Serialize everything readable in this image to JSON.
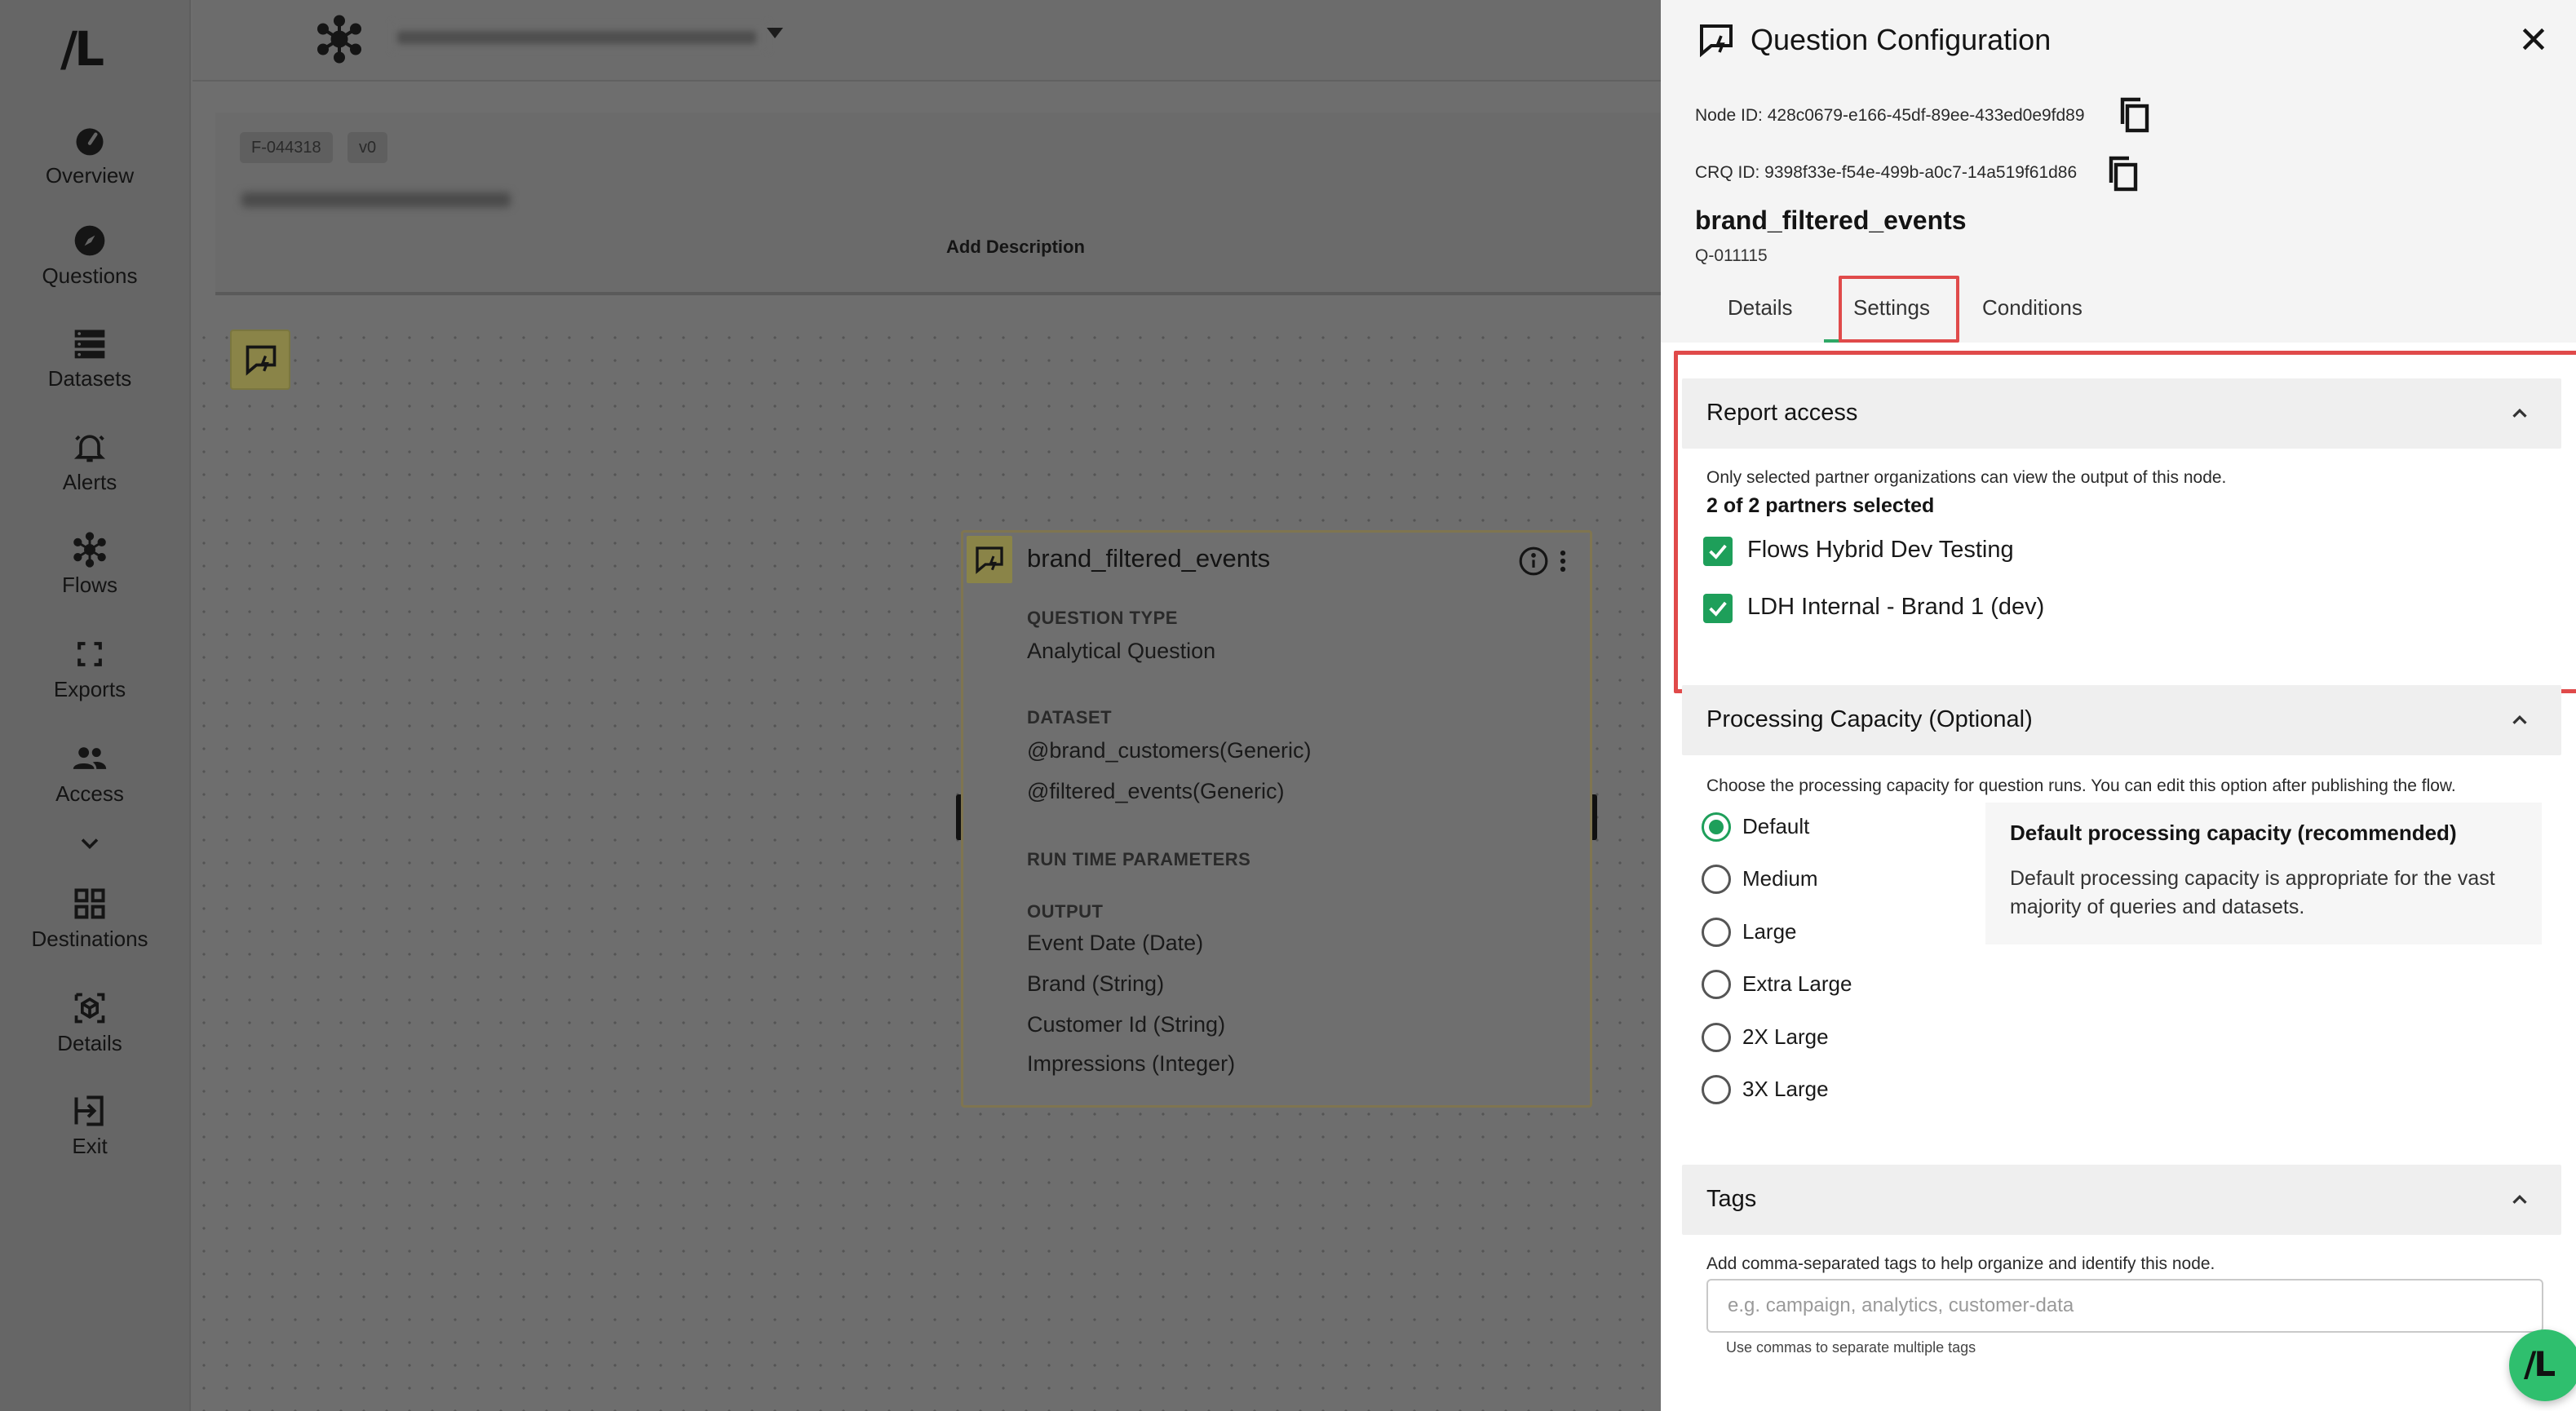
{
  "rail": {
    "logo": "/L",
    "items": [
      {
        "label": "Overview",
        "icon": "gauge-icon"
      },
      {
        "label": "Questions",
        "icon": "compass-icon"
      },
      {
        "label": "Datasets",
        "icon": "database-icon"
      },
      {
        "label": "Alerts",
        "icon": "bell-icon"
      },
      {
        "label": "Flows",
        "icon": "flow-network-icon"
      },
      {
        "label": "Exports",
        "icon": "frame-corners-icon"
      },
      {
        "label": "Access",
        "icon": "people-icon"
      },
      {
        "label": "Destinations",
        "icon": "grid-icon"
      },
      {
        "label": "Details",
        "icon": "cube-icon"
      },
      {
        "label": "Exit",
        "icon": "exit-icon"
      }
    ]
  },
  "flow_card": {
    "badge_id": "F-044318",
    "badge_version": "v0",
    "add_description": "Add Description"
  },
  "question_node": {
    "title": "brand_filtered_events",
    "question_type_label": "QUESTION TYPE",
    "question_type": "Analytical Question",
    "dataset_label": "DATASET",
    "datasets": [
      "@brand_customers(Generic)",
      "@filtered_events(Generic)"
    ],
    "runtime_label": "RUN TIME PARAMETERS",
    "output_label": "OUTPUT",
    "outputs": [
      "Event Date (Date)",
      "Brand (String)",
      "Customer Id (String)",
      "Impressions (Integer)"
    ]
  },
  "panel": {
    "title": "Question Configuration",
    "node_id": "Node ID: 428c0679-e166-45df-89ee-433ed0e9fd89",
    "crq_id": "CRQ ID: 9398f33e-f54e-499b-a0c7-14a519f61d86",
    "name": "brand_filtered_events",
    "qid": "Q-011115",
    "tabs": [
      "Details",
      "Settings",
      "Conditions"
    ],
    "active_tab": "Settings"
  },
  "report_access": {
    "title": "Report access",
    "description": "Only selected partner organizations can view the output of this node.",
    "selected_count": "2 of 2 partners selected",
    "partners": [
      "Flows Hybrid Dev Testing",
      "LDH Internal - Brand 1 (dev)"
    ]
  },
  "processing": {
    "title": "Processing Capacity (Optional)",
    "description": "Choose the processing capacity for question runs. You can edit this option after publishing the flow.",
    "options": [
      "Default",
      "Medium",
      "Large",
      "Extra Large",
      "2X Large",
      "3X Large"
    ],
    "selected": "Default",
    "info_title": "Default processing capacity (recommended)",
    "info_text": "Default processing capacity is appropriate for the vast majority of queries and datasets."
  },
  "tags": {
    "title": "Tags",
    "description": "Add comma-separated tags to help organize and identify this node.",
    "placeholder": "e.g. campaign, analytics, customer-data",
    "help": "Use commas to separate multiple tags"
  },
  "fab_logo": "/L",
  "colors": {
    "accent": "#1e9f5a",
    "highlight": "#e04a4a",
    "node": "#8a8448"
  }
}
